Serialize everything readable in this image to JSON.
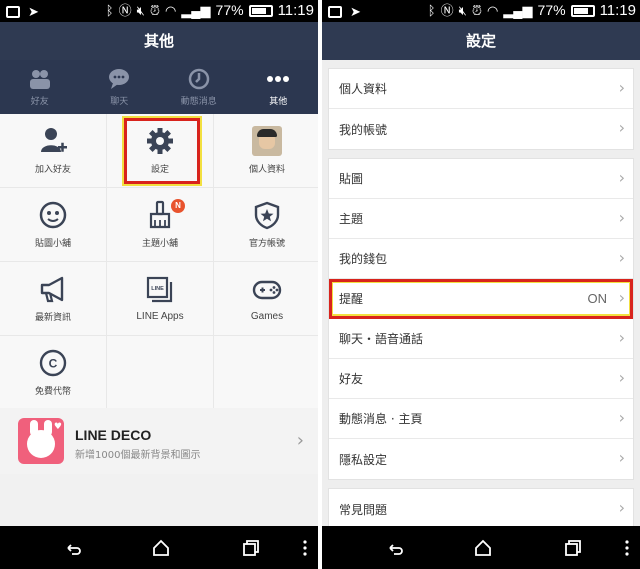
{
  "status_bar": {
    "battery": "77%",
    "time": "11:19"
  },
  "left_screen": {
    "title": "其他",
    "tabs": [
      {
        "label": "好友",
        "icon": "friends-icon"
      },
      {
        "label": "聊天",
        "icon": "chat-icon"
      },
      {
        "label": "動態消息",
        "icon": "clock-icon"
      },
      {
        "label": "其他",
        "icon": "more-icon"
      }
    ],
    "grid": [
      {
        "label": "加入好友",
        "icon": "add-friend-icon"
      },
      {
        "label": "設定",
        "icon": "gear-icon"
      },
      {
        "label": "個人資料",
        "icon": "avatar"
      },
      {
        "label": "貼圖小舖",
        "icon": "sticker-icon"
      },
      {
        "label": "主題小舖",
        "icon": "brush-icon",
        "badge": "N"
      },
      {
        "label": "官方帳號",
        "icon": "shield-star-icon"
      },
      {
        "label": "最新資訊",
        "icon": "megaphone-icon"
      },
      {
        "label": "LINE Apps",
        "icon": "line-apps-icon"
      },
      {
        "label": "Games",
        "icon": "gamepad-icon"
      },
      {
        "label": "免費代幣",
        "icon": "coin-icon"
      }
    ],
    "deco": {
      "title": "LINE DECO",
      "subtitle": "新增1000個最新背景和圖示"
    }
  },
  "right_screen": {
    "title": "設定",
    "groups": [
      [
        {
          "label": "個人資料"
        },
        {
          "label": "我的帳號"
        }
      ],
      [
        {
          "label": "貼圖"
        },
        {
          "label": "主題"
        },
        {
          "label": "我的錢包"
        },
        {
          "label": "提醒",
          "value": "ON"
        },
        {
          "label": "聊天・語音通話"
        },
        {
          "label": "好友"
        },
        {
          "label": "動態消息 · 主頁"
        },
        {
          "label": "隱私設定"
        }
      ],
      [
        {
          "label": "常見問題"
        }
      ]
    ]
  },
  "colors": {
    "header": "#2f3a52",
    "highlight_border": "#d8231c",
    "highlight_glow": "#f2e040",
    "badge": "#e8532d"
  }
}
